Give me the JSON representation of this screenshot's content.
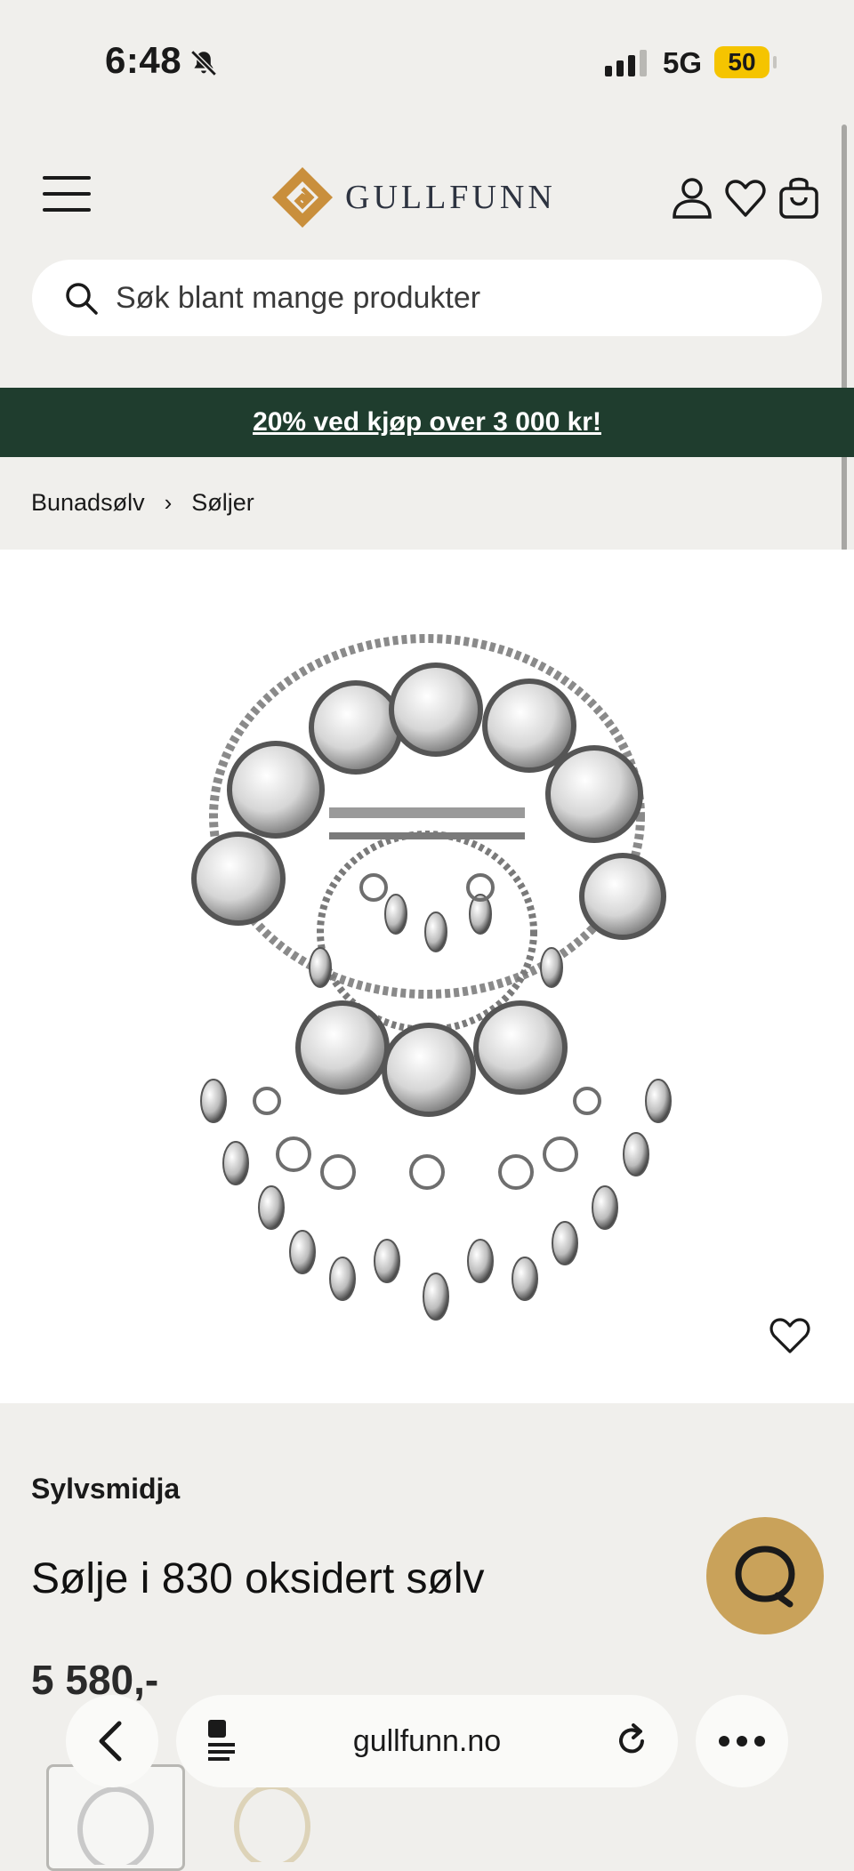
{
  "status_bar": {
    "time": "6:48",
    "network": "5G",
    "battery": "50"
  },
  "header": {
    "brand": "GULLFUNN",
    "accent": "#c98f3c"
  },
  "search": {
    "placeholder": "Søk blant mange produkter"
  },
  "promo": {
    "text": "20% ved kjøp over 3 000 kr!",
    "background": "#1f3d2e"
  },
  "breadcrumb": {
    "items": [
      "Bunadsølv",
      "Søljer"
    ]
  },
  "product": {
    "brand": "Sylvsmidja",
    "title": "Sølje i 830 oksidert sølv",
    "price": "5 580,-"
  },
  "browser": {
    "url": "gullfunn.no"
  },
  "colors": {
    "chat_button": "#c9a25a",
    "background": "#f0efec"
  }
}
